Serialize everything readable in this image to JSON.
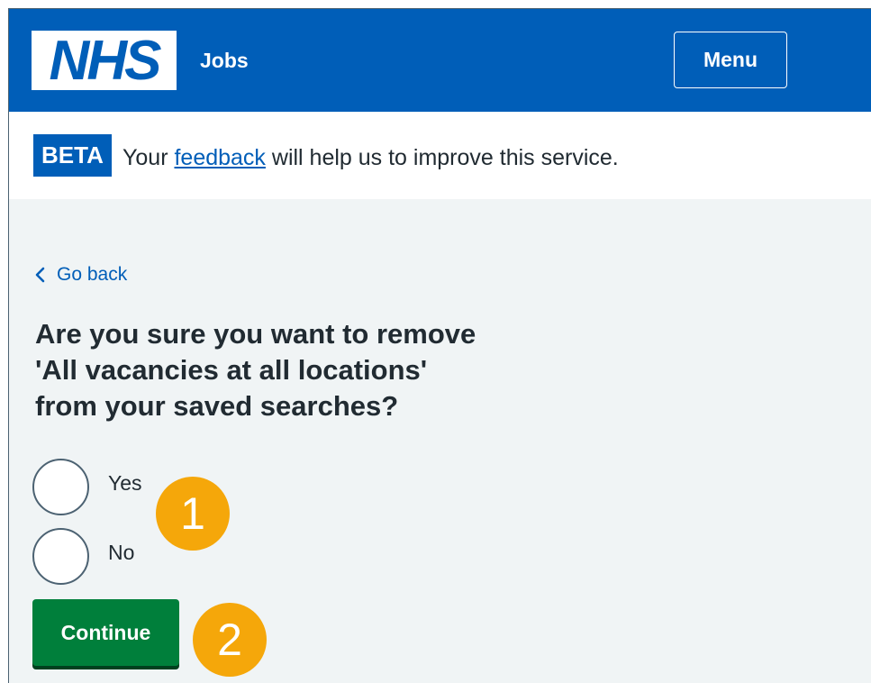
{
  "header": {
    "logo_text": "NHS",
    "service_name": "Jobs",
    "menu_label": "Menu",
    "brand_color": "#005eb8"
  },
  "beta_banner": {
    "tag": "BETA",
    "text_before": "Your ",
    "link_text": "feedback",
    "text_after": " will help us to improve this service."
  },
  "main": {
    "back_link": "Go back",
    "question_lines": [
      "Are you sure you want to remove",
      "'All vacancies at all locations'",
      "from your saved searches?"
    ],
    "options": [
      {
        "label": "Yes",
        "selected": false
      },
      {
        "label": "No",
        "selected": false
      }
    ],
    "continue_label": "Continue",
    "continue_color": "#007f3b"
  },
  "callouts": {
    "one": "1",
    "two": "2",
    "color": "#f5a70a"
  }
}
